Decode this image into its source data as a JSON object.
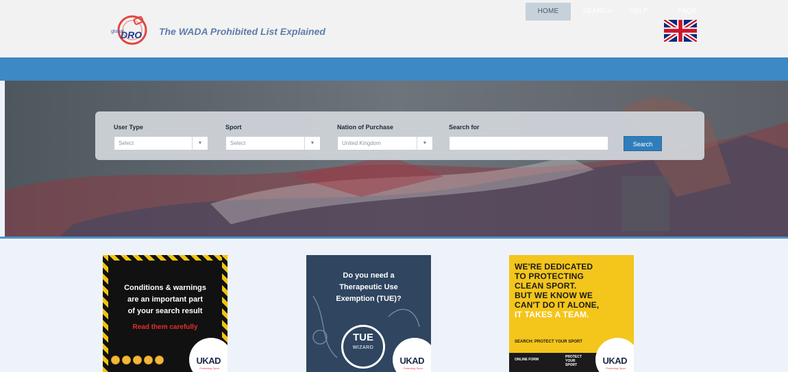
{
  "header": {
    "logo_text": "DRO",
    "logo_small": "global",
    "tagline": "The WADA Prohibited List Explained",
    "language_flag_icon": "uk-flag-icon"
  },
  "nav": {
    "items": [
      {
        "label": "HOME",
        "active": true
      },
      {
        "label": "SEARCH"
      },
      {
        "label": "HELP"
      },
      {
        "label": "FAQS"
      }
    ]
  },
  "search_form": {
    "user_type": {
      "label": "User Type",
      "value": "Select"
    },
    "sport": {
      "label": "Sport",
      "value": "Select"
    },
    "nation": {
      "label": "Nation of Purchase",
      "value": "United Kingdom"
    },
    "search_for": {
      "label": "Search for",
      "value": "",
      "placeholder": ""
    },
    "button_label": "Search"
  },
  "cards": [
    {
      "lines": [
        "Conditions & warnings",
        "are an important part",
        "of your search result"
      ],
      "highlight": "Read them carefully",
      "brand": "UKAD",
      "brand_sub": "Protecting Sport"
    },
    {
      "lines": [
        "Do you need a",
        "Therapeutic Use",
        "Exemption (TUE)?"
      ],
      "badge_title": "TUE",
      "badge_sub": "WIZARD",
      "brand": "UKAD",
      "brand_sub": "Protecting Sport"
    },
    {
      "lines": [
        "WE'RE DEDICATED",
        "TO PROTECTING",
        "CLEAN SPORT.",
        "BUT WE KNOW WE",
        "CAN'T DO IT ALONE,"
      ],
      "highlight": "IT TAKES A TEAM.",
      "tagline": "SEARCH: PROTECT YOUR SPORT",
      "strip_left": "ONLINE FORM",
      "strip_right": "PROTECT YOUR SPORT",
      "brand": "UKAD",
      "brand_sub": "Protecting Sport"
    }
  ],
  "colors": {
    "nav": "#3c89c5",
    "accent": "#2f7ebb",
    "tagline": "#5d7dab"
  }
}
